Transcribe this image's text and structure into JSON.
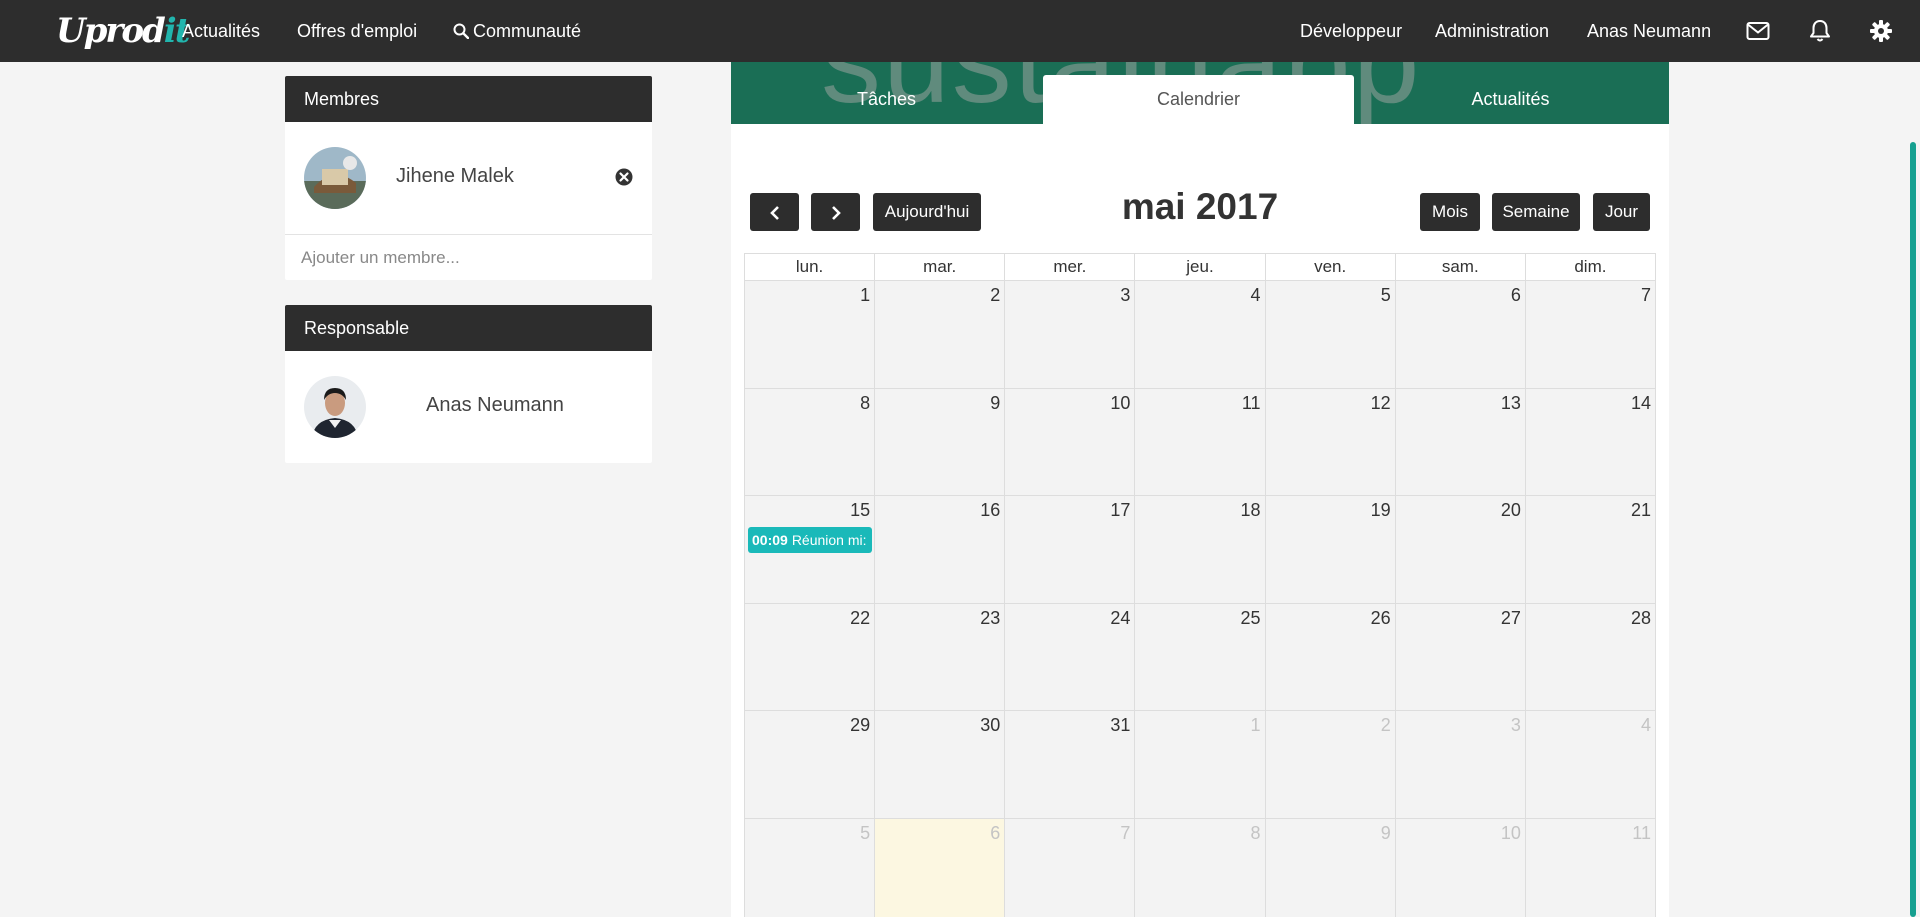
{
  "app": {
    "logo_main": "Uprod",
    "logo_accent": "it"
  },
  "topnav": {
    "left_items": [
      "Actualités",
      "Offres d'emploi",
      "Communauté"
    ],
    "right_items": [
      "Développeur",
      "Administration",
      "Anas Neumann"
    ],
    "icons": [
      "mail-icon",
      "bell-icon",
      "gear-icon"
    ]
  },
  "members_panel": {
    "title": "Membres",
    "members": [
      {
        "name": "Jihene Malek"
      }
    ],
    "add_placeholder": "Ajouter un membre..."
  },
  "manager_panel": {
    "title": "Responsable",
    "name": "Anas Neumann"
  },
  "banner": {
    "watermark": "sustainapp"
  },
  "tabs": [
    {
      "label": "Tâches",
      "active": false
    },
    {
      "label": "Calendrier",
      "active": true
    },
    {
      "label": "Actualités",
      "active": false
    }
  ],
  "calendar": {
    "title": "mai 2017",
    "today_label": "Aujourd'hui",
    "views": [
      "Mois",
      "Semaine",
      "Jour"
    ],
    "weekdays": [
      "lun.",
      "mar.",
      "mer.",
      "jeu.",
      "ven.",
      "sam.",
      "dim."
    ],
    "weeks": [
      [
        {
          "d": "1"
        },
        {
          "d": "2"
        },
        {
          "d": "3"
        },
        {
          "d": "4"
        },
        {
          "d": "5"
        },
        {
          "d": "6"
        },
        {
          "d": "7"
        }
      ],
      [
        {
          "d": "8"
        },
        {
          "d": "9"
        },
        {
          "d": "10"
        },
        {
          "d": "11"
        },
        {
          "d": "12"
        },
        {
          "d": "13"
        },
        {
          "d": "14"
        }
      ],
      [
        {
          "d": "15"
        },
        {
          "d": "16"
        },
        {
          "d": "17"
        },
        {
          "d": "18"
        },
        {
          "d": "19"
        },
        {
          "d": "20"
        },
        {
          "d": "21"
        }
      ],
      [
        {
          "d": "22"
        },
        {
          "d": "23"
        },
        {
          "d": "24"
        },
        {
          "d": "25"
        },
        {
          "d": "26"
        },
        {
          "d": "27"
        },
        {
          "d": "28"
        }
      ],
      [
        {
          "d": "29"
        },
        {
          "d": "30"
        },
        {
          "d": "31"
        },
        {
          "d": "1",
          "other": true
        },
        {
          "d": "2",
          "other": true
        },
        {
          "d": "3",
          "other": true
        },
        {
          "d": "4",
          "other": true
        }
      ],
      [
        {
          "d": "5",
          "other": true
        },
        {
          "d": "6",
          "other": true,
          "today": true
        },
        {
          "d": "7",
          "other": true
        },
        {
          "d": "8",
          "other": true
        },
        {
          "d": "9",
          "other": true
        },
        {
          "d": "10",
          "other": true
        },
        {
          "d": "11",
          "other": true
        }
      ]
    ],
    "events": [
      {
        "week": 2,
        "day": 0,
        "time": "00:09",
        "title": "Réunion mi:"
      }
    ]
  },
  "colors": {
    "nav_bg": "#2d2d2d",
    "banner_bg": "#1a6e55",
    "event_bg": "#1ab9b9",
    "today_bg": "#fcf7e1",
    "scroll_thumb": "#16a090"
  }
}
